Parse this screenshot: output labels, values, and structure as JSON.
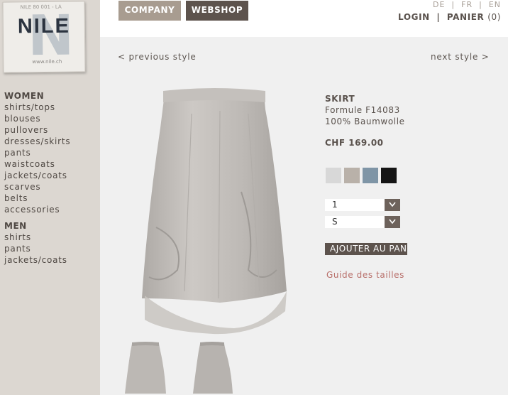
{
  "logo": {
    "text": "NILE",
    "url": "www.nile.ch",
    "scribble": "NILE  80  001  - LA"
  },
  "header": {
    "company_label": "COMPANY",
    "webshop_label": "WEBSHOP",
    "languages": [
      "DE",
      "FR",
      "EN"
    ],
    "login_label": "LOGIN",
    "cart_label": "PANIER",
    "cart_count": "(0)"
  },
  "sidebar": {
    "women_title": "WOMEN",
    "women_items": [
      "shirts/tops",
      "blouses",
      "pullovers",
      "dresses/skirts",
      "pants",
      "waistcoats",
      "jackets/coats",
      "scarves",
      "belts",
      "accessories"
    ],
    "men_title": "MEN",
    "men_items": [
      "shirts",
      "pants",
      "jackets/coats"
    ]
  },
  "nav": {
    "previous": "< previous style",
    "next": "next style >"
  },
  "product": {
    "type": "SKIRT",
    "model": "Formule F14083",
    "material": "100% Baumwolle",
    "price": "CHF 169.00",
    "swatches": [
      {
        "name": "light-grey",
        "color": "#d8d8d8"
      },
      {
        "name": "taupe",
        "color": "#b9b1a9"
      },
      {
        "name": "denim-blue",
        "color": "#7f95a6"
      },
      {
        "name": "black",
        "color": "#151515"
      }
    ],
    "quantity_value": "1",
    "size_value": "S",
    "add_to_cart_label": "AJOUTER AU PANIER",
    "size_guide_label": "Guide des tailles"
  },
  "colors": {
    "accent_dark": "#5d534d",
    "accent_light": "#a89c90",
    "sidebar_bg": "#dcd7d1",
    "link_red": "#b86f6a"
  },
  "icons": {
    "dropdown": "chevron-down-icon"
  }
}
